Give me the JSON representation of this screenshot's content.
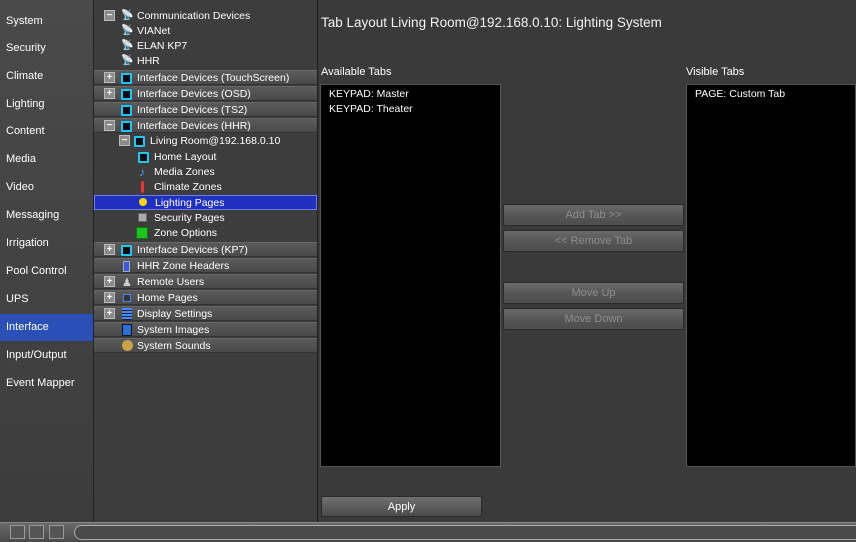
{
  "nav": {
    "items": [
      "System",
      "Security",
      "Climate",
      "Lighting",
      "Content",
      "Media",
      "Video",
      "Messaging",
      "Irrigation",
      "Pool Control",
      "UPS",
      "Interface",
      "Input/Output",
      "Event Mapper"
    ],
    "active": "Interface"
  },
  "tree": {
    "communication_devices": "Communication Devices",
    "vianet": "VIANet",
    "elan_kp7": "ELAN KP7",
    "hhr": "HHR",
    "interface_touchscreen": "Interface Devices (TouchScreen)",
    "interface_osd": "Interface Devices (OSD)",
    "interface_ts2": "Interface Devices (TS2)",
    "interface_hhr": "Interface Devices (HHR)",
    "living_room": "Living Room@192.168.0.10",
    "home_layout": "Home Layout",
    "media_zones": "Media Zones",
    "climate_zones": "Climate Zones",
    "lighting_pages": "Lighting Pages",
    "security_pages": "Security Pages",
    "zone_options": "Zone Options",
    "interface_kp7": "Interface Devices (KP7)",
    "hhr_zone_headers": "HHR Zone Headers",
    "remote_users": "Remote Users",
    "home_pages": "Home Pages",
    "display_settings": "Display Settings",
    "system_images": "System Images",
    "system_sounds": "System Sounds",
    "expand_symbol": "+",
    "collapse_symbol": "−"
  },
  "main": {
    "title": "Tab Layout Living Room@192.168.0.10: Lighting System",
    "available_label": "Available Tabs",
    "visible_label": "Visible Tabs",
    "available_tabs": [
      "KEYPAD: Master",
      "KEYPAD: Theater"
    ],
    "visible_tabs": [
      "PAGE: Custom Tab"
    ],
    "add_tab": "Add Tab >>",
    "remove_tab": "<< Remove Tab",
    "move_up": "Move Up",
    "move_down": "Move Down",
    "apply": "Apply"
  },
  "colors": {
    "accent": "#2a50b8",
    "selection": "#1f2fc0"
  }
}
